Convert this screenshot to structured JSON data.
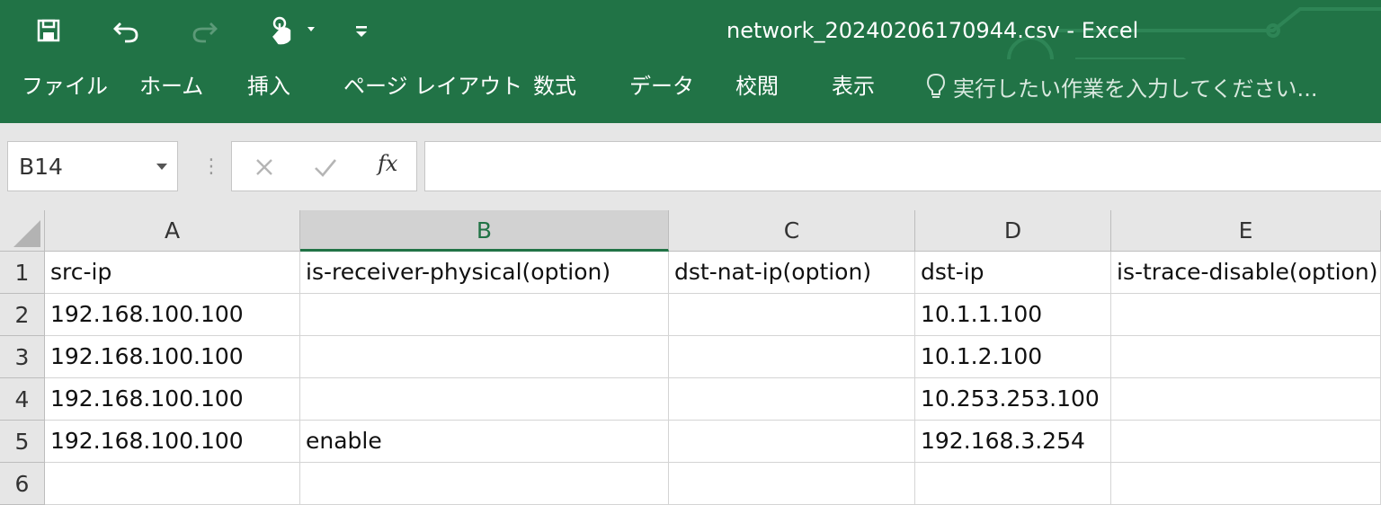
{
  "window": {
    "title": "network_20240206170944.csv - Excel"
  },
  "quick_access": {
    "icons": [
      "save-icon",
      "undo-icon",
      "redo-icon",
      "touch-mode-icon",
      "customize-qat-icon"
    ]
  },
  "ribbon": {
    "tabs": [
      "ファイル",
      "ホーム",
      "挿入",
      "ページ レイアウト",
      "数式",
      "データ",
      "校閲",
      "表示"
    ],
    "tell_me_placeholder": "実行したい作業を入力してください..."
  },
  "formula_bar": {
    "name_box": "B14",
    "formula_value": "",
    "fx_label": "fx"
  },
  "sheet": {
    "columns": [
      "A",
      "B",
      "C",
      "D",
      "E"
    ],
    "active_column": "B",
    "row_numbers": [
      "1",
      "2",
      "3",
      "4",
      "5",
      "6"
    ],
    "rows": [
      [
        "src-ip",
        "is-receiver-physical(option)",
        "dst-nat-ip(option)",
        "dst-ip",
        "is-trace-disable(option)"
      ],
      [
        "192.168.100.100",
        "",
        "",
        "10.1.1.100",
        ""
      ],
      [
        "192.168.100.100",
        "",
        "",
        "10.1.2.100",
        ""
      ],
      [
        "192.168.100.100",
        "",
        "",
        "10.253.253.100",
        ""
      ],
      [
        "192.168.100.100",
        "enable",
        "",
        "192.168.3.254",
        ""
      ],
      [
        "",
        "",
        "",
        "",
        ""
      ]
    ]
  },
  "colors": {
    "excel_green": "#217346",
    "header_gray": "#e6e6e6",
    "active_header": "#d2d2d2"
  }
}
